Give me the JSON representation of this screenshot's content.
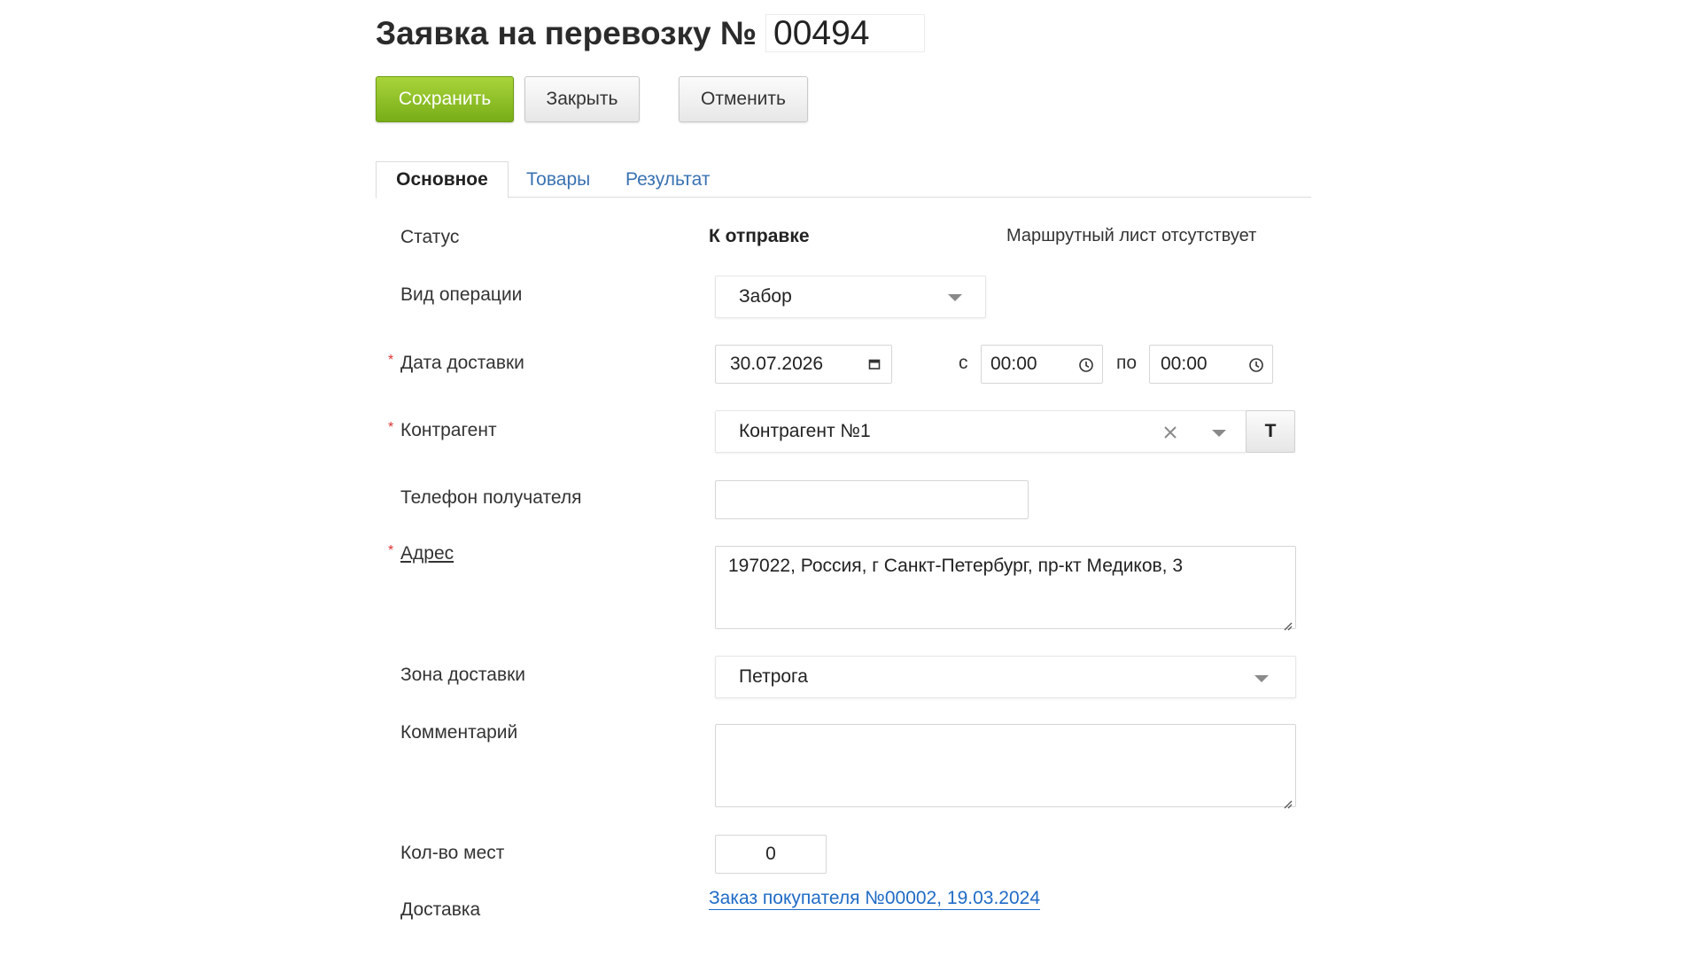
{
  "header": {
    "title": "Заявка на перевозку №",
    "number": "00494"
  },
  "toolbar": {
    "save_label": "Сохранить",
    "close_label": "Закрыть",
    "cancel_label": "Отменить"
  },
  "tabs": [
    {
      "label": "Основное",
      "active": true
    },
    {
      "label": "Товары",
      "active": false
    },
    {
      "label": "Результат",
      "active": false
    }
  ],
  "form": {
    "status": {
      "label": "Статус",
      "value": "К отправке",
      "route_info": "Маршрутный лист отсутствует"
    },
    "operation": {
      "label": "Вид операции",
      "value": "Забор"
    },
    "delivery_date": {
      "required_mark": "*",
      "label": "Дата доставки",
      "value": "30.07.2026",
      "from_label": "с",
      "from_time": "00:00",
      "to_label": "по",
      "to_time": "00:00"
    },
    "counterparty": {
      "required_mark": "*",
      "label": "Контрагент",
      "value": "Контрагент №1",
      "type_button": "Т"
    },
    "phone": {
      "label": "Телефон получателя",
      "value": ""
    },
    "address": {
      "required_mark": "*",
      "label": "Адрес",
      "value": "197022, Россия, г Санкт-Петербург, пр-кт Медиков, 3"
    },
    "zone": {
      "label": "Зона доставки",
      "value": "Петрога"
    },
    "comment": {
      "label": "Комментарий",
      "value": ""
    },
    "places": {
      "label": "Кол-во мест",
      "value": "0"
    },
    "delivery": {
      "label": "Доставка",
      "link": "Заказ покупателя №00002, 19.03.2024"
    }
  },
  "colors": {
    "save_button": "#8bbf22",
    "link": "#1f6bc6",
    "tab_link": "#3a72b2",
    "required": "#dd3333"
  },
  "icons": [
    "calendar-icon",
    "clock-icon",
    "clear-icon",
    "chevron-down-icon",
    "resize-grip-icon"
  ]
}
